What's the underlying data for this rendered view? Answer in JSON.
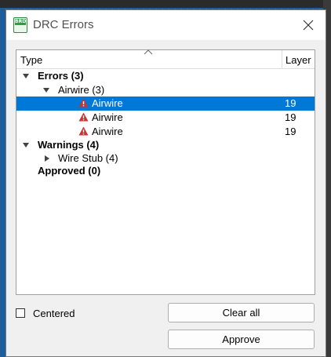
{
  "window": {
    "title": "DRC Errors",
    "app_icon_text": "BRD"
  },
  "tree": {
    "columns": {
      "type": "Type",
      "layer": "Layer"
    },
    "rows": [
      {
        "text": "Errors (3)",
        "bold": true,
        "expander": "expanded",
        "layer": ""
      },
      {
        "text": "Airwire (3)",
        "bold": false,
        "expander": "expanded",
        "layer": ""
      },
      {
        "text": "Airwire",
        "bold": false,
        "icon": "warning-icon",
        "layer": "19",
        "selected": true
      },
      {
        "text": "Airwire",
        "bold": false,
        "icon": "warning-icon",
        "layer": "19",
        "selected": false
      },
      {
        "text": "Airwire",
        "bold": false,
        "icon": "warning-icon",
        "layer": "19",
        "selected": false
      },
      {
        "text": "Warnings (4)",
        "bold": true,
        "expander": "expanded",
        "layer": ""
      },
      {
        "text": "Wire Stub (4)",
        "bold": false,
        "expander": "collapsed",
        "layer": ""
      },
      {
        "text": "Approved (0)",
        "bold": true,
        "expander": "none",
        "layer": ""
      }
    ]
  },
  "options": {
    "centered_label": "Centered",
    "centered_checked": false
  },
  "buttons": {
    "clear_all": "Clear all",
    "approve": "Approve"
  },
  "colors": {
    "selection": "#0078d7",
    "warning": "#d32f2f",
    "brd_icon": "#2e9e44"
  }
}
